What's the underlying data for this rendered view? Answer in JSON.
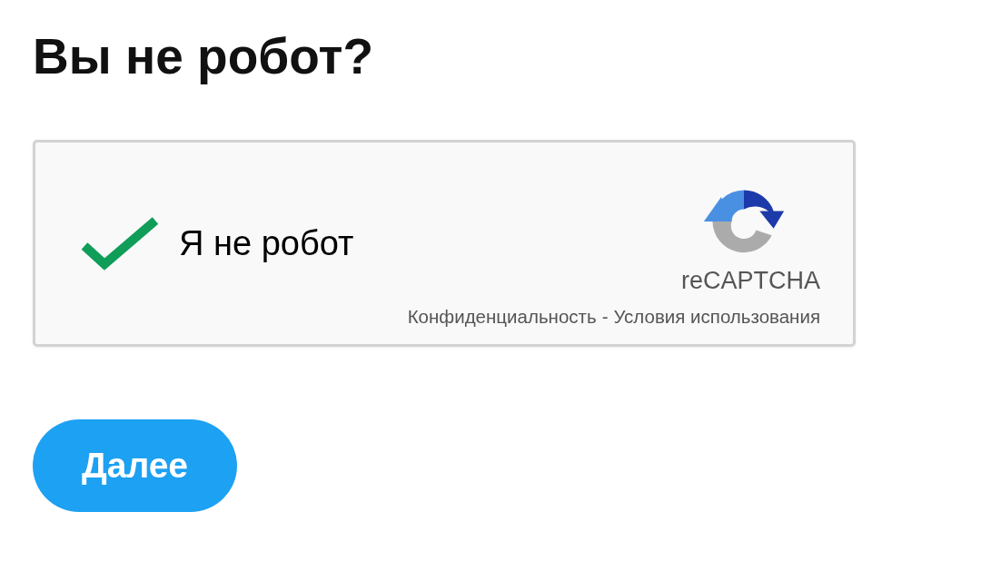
{
  "title": "Вы не робот?",
  "captcha": {
    "checked": true,
    "label": "Я не робот",
    "brand": "reCAPTCHA",
    "links": [
      "Конфиденциальность",
      "Условия использования"
    ],
    "separator": "-"
  },
  "button": {
    "label": "Далее"
  }
}
